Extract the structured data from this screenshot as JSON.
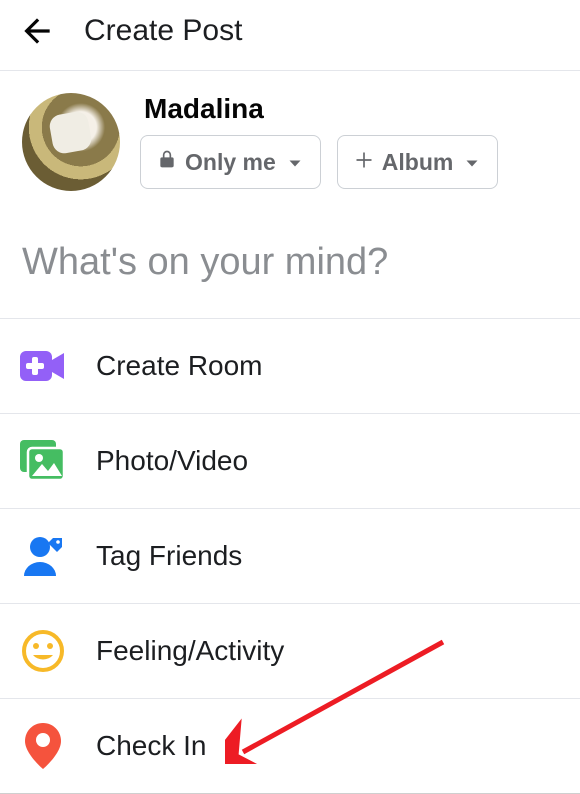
{
  "header": {
    "title": "Create Post"
  },
  "profile": {
    "username": "Madalina",
    "privacy_label": "Only me",
    "album_label": "Album"
  },
  "composer": {
    "placeholder": "What's on your mind?"
  },
  "options": [
    {
      "label": "Create Room"
    },
    {
      "label": "Photo/Video"
    },
    {
      "label": "Tag Friends"
    },
    {
      "label": "Feeling/Activity"
    },
    {
      "label": "Check In"
    }
  ],
  "colors": {
    "create_room_icon": "#9360f7",
    "photo_icon": "#45bd62",
    "tag_icon": "#1877f2",
    "feeling_icon": "#f7b928",
    "checkin_icon": "#f5533d",
    "arrow": "#ed1c24"
  }
}
